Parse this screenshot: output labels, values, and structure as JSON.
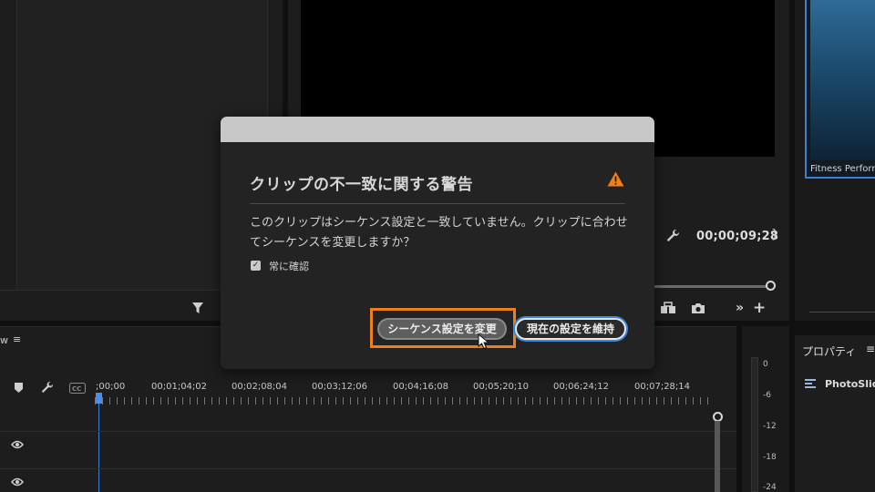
{
  "dialog": {
    "title": "クリップの不一致に関する警告",
    "message": "このクリップはシーケンス設定と一致していません。クリップに合わせてシーケンスを変更しますか？",
    "checkbox_label": "常に確認",
    "checkbox_checked": true,
    "change_button": "シーケンス設定を変更",
    "keep_button": "現在の設定を維持",
    "warning_color": "#f07f1a",
    "highlight_color": "#f07f1a"
  },
  "monitor": {
    "timecode": "00;00;09;28",
    "brace": "}"
  },
  "project": {
    "thumbnail_label": "Fitness Perforr"
  },
  "timeline": {
    "tab_label": "w",
    "tab_menu": "≡",
    "ruler": ";00;00",
    "ruler_labels": [
      "00;01;04;02",
      "00;02;08;04",
      "00;03;12;06",
      "00;04;16;08",
      "00;05;20;10",
      "00;06;24;12",
      "00;07;28;14"
    ]
  },
  "meter": {
    "labels": [
      "0",
      "-6",
      "-12",
      "-18",
      "-24"
    ]
  },
  "properties": {
    "title": "プロパティ",
    "menu": "≡",
    "item": "PhotoSlide"
  },
  "icons": {
    "filter": "filter-icon",
    "wrench": "wrench-icon",
    "camera": "camera-icon",
    "add": "plus-icon",
    "more": "double-chevron-icon",
    "marker": "marker-icon",
    "cc": "closed-caption-icon",
    "eye": "eye-icon"
  }
}
